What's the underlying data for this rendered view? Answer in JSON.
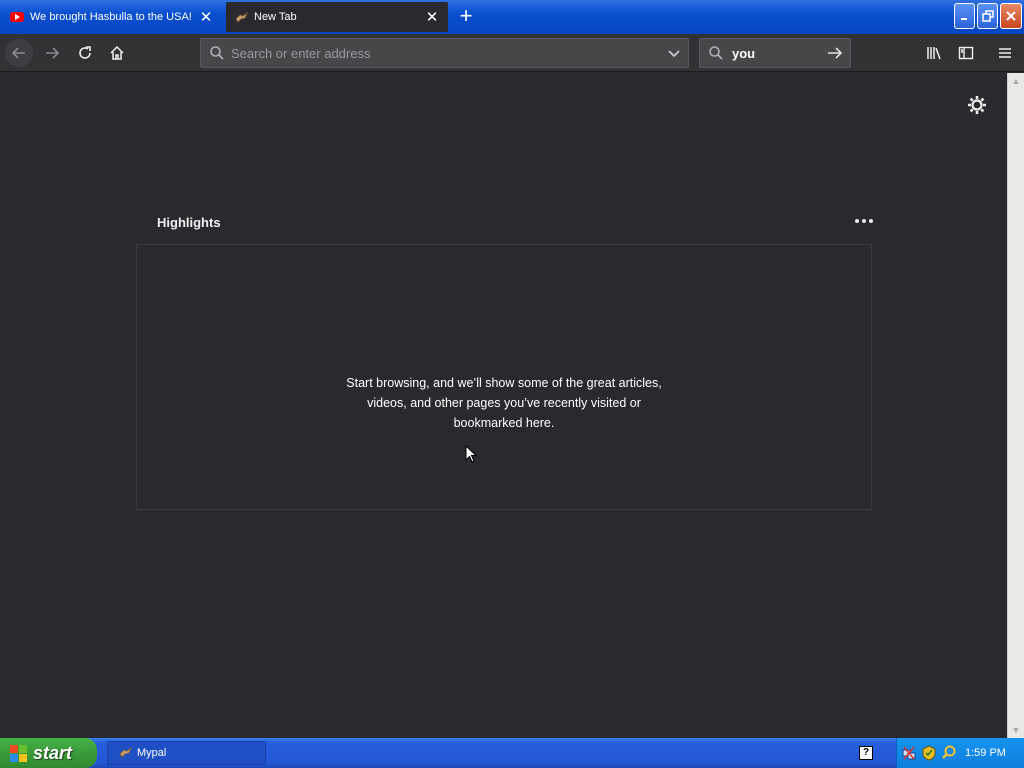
{
  "tabs": [
    {
      "title": "We brought Hasbulla to the USA!",
      "icon": "youtube-icon",
      "active": false
    },
    {
      "title": "New Tab",
      "icon": "mypal-icon",
      "active": true
    }
  ],
  "toolbar": {
    "url_placeholder": "Search or enter address",
    "search_value": "you"
  },
  "highlights": {
    "title": "Highlights",
    "empty_message": "Start browsing, and we’ll show some of the great articles, videos, and other pages you’ve recently visited or bookmarked here."
  },
  "taskbar": {
    "start_label": "start",
    "window_label": "Mypal",
    "clock": "1:59 PM",
    "help_label": "?"
  },
  "colors": {
    "titlebar_blue": "#0a4fd0",
    "content_bg": "#2a2a2e",
    "taskbar_blue": "#245edb",
    "start_green": "#3a9b3a"
  }
}
